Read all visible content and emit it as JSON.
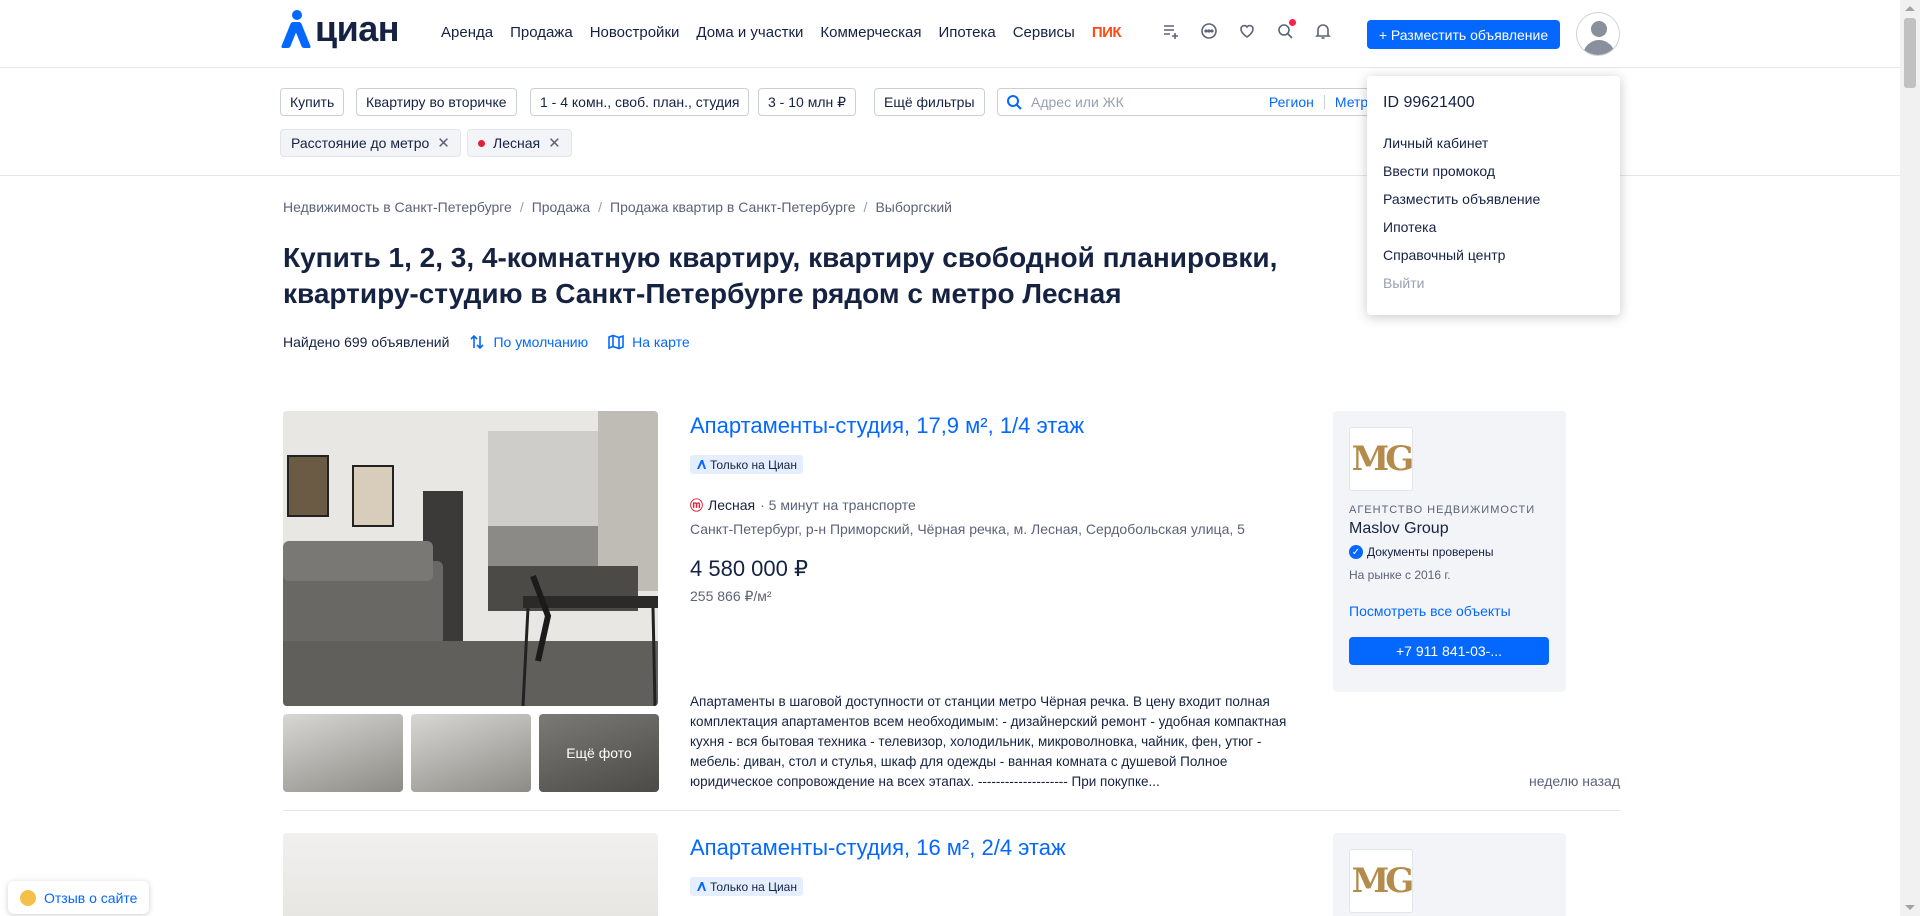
{
  "brand": {
    "logo_text": "циан",
    "accent": "#0468ff"
  },
  "nav": [
    "Аренда",
    "Продажа",
    "Новостройки",
    "Дома и участки",
    "Коммерческая",
    "Ипотека",
    "Сервисы"
  ],
  "nav_pik": "ПИК",
  "header_icons": [
    "compare-list-icon",
    "chat-icon",
    "heart-icon",
    "saved-search-icon",
    "bell-icon"
  ],
  "post_button": "+ Разместить объявление",
  "filters": {
    "buy": "Купить",
    "type": "Квартиру во вторичке",
    "rooms": "1 - 4 комн., своб. план., студия",
    "price": "3 - 10 млн ₽",
    "more": "Ещё фильтры",
    "search_placeholder": "Адрес или ЖК",
    "region": "Регион",
    "metro": "Метро",
    "tags": [
      "Расстояние до метро",
      "Лесная"
    ]
  },
  "breadcrumbs": [
    "Недвижимость в Санкт-Петербурге",
    "Продажа",
    "Продажа квартир в Санкт-Петербурге",
    "Выборгский"
  ],
  "page_title": "Купить 1, 2, 3, 4-комнатную квартиру, квартиру свободной планировки, квартиру-студию в Санкт-Петербурге рядом с метро Лесная",
  "found": "Найдено 699 объявлений",
  "sort": "По умолчанию",
  "map": "На карте",
  "dropdown": {
    "user_id": "ID 99621400",
    "items": [
      "Личный кабинет",
      "Ввести промокод",
      "Разместить объявление",
      "Ипотека",
      "Справочный центр"
    ],
    "logout": "Выйти"
  },
  "listings": [
    {
      "title": "Апартаменты-студия, 17,9 м², 1/4 этаж",
      "badge": "Только на Циан",
      "metro": "Лесная",
      "metro_time": "· 5 минут на транспорте",
      "address": "Санкт-Петербург, р-н Приморский, Чёрная речка, м. Лесная, Сердобольская улица, 5",
      "price": "4 580 000 ₽",
      "price_per_m": "255 866 ₽/м²",
      "more_photos": "Ещё фото",
      "description": "Апартаменты в шаговой доступности от станции метро Чёрная речка. В цену входит полная комплектация апартаментов всем необходимым: - дизайнерский ремонт - удобная компактная кухня - вся бытовая техника - телевизор, холодильник, микроволновка, чайник, фен, утюг - мебель: диван, стол и стулья, шкаф для одежды - ванная комната с душевой Полное юридическое сопровождение на всех этапах. -------------------- При покупке...",
      "date": "неделю назад",
      "agency": {
        "type": "АГЕНТСТВО НЕДВИЖИМОСТИ",
        "name": "Maslov Group",
        "verified": "Документы проверены",
        "since": "На рынке с 2016 г.",
        "all_link": "Посмотреть все объекты",
        "phone": "+7 911 841-03-..."
      }
    },
    {
      "title": "Апартаменты-студия, 16 м², 2/4 этаж",
      "badge": "Только на Циан"
    }
  ],
  "feedback": "Отзыв о сайте"
}
